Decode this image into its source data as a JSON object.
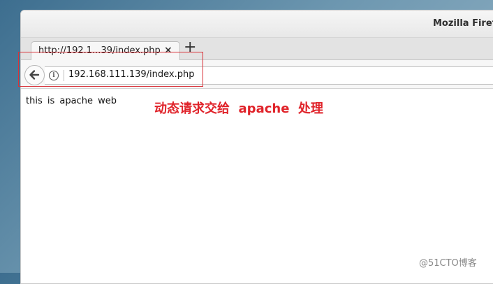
{
  "window": {
    "title": "Mozilla Firefo"
  },
  "tab": {
    "title": "http://192.1...39/index.php",
    "close_glyph": "×"
  },
  "new_tab_glyph": "+",
  "urlbar": {
    "value": "192.168.111.139/index.php"
  },
  "page": {
    "body_text": "this is apache web"
  },
  "annotation": {
    "text": "动态请求交给  apache  处理",
    "color": "#e0232a"
  },
  "watermark": {
    "text": "@51CTO博客"
  }
}
